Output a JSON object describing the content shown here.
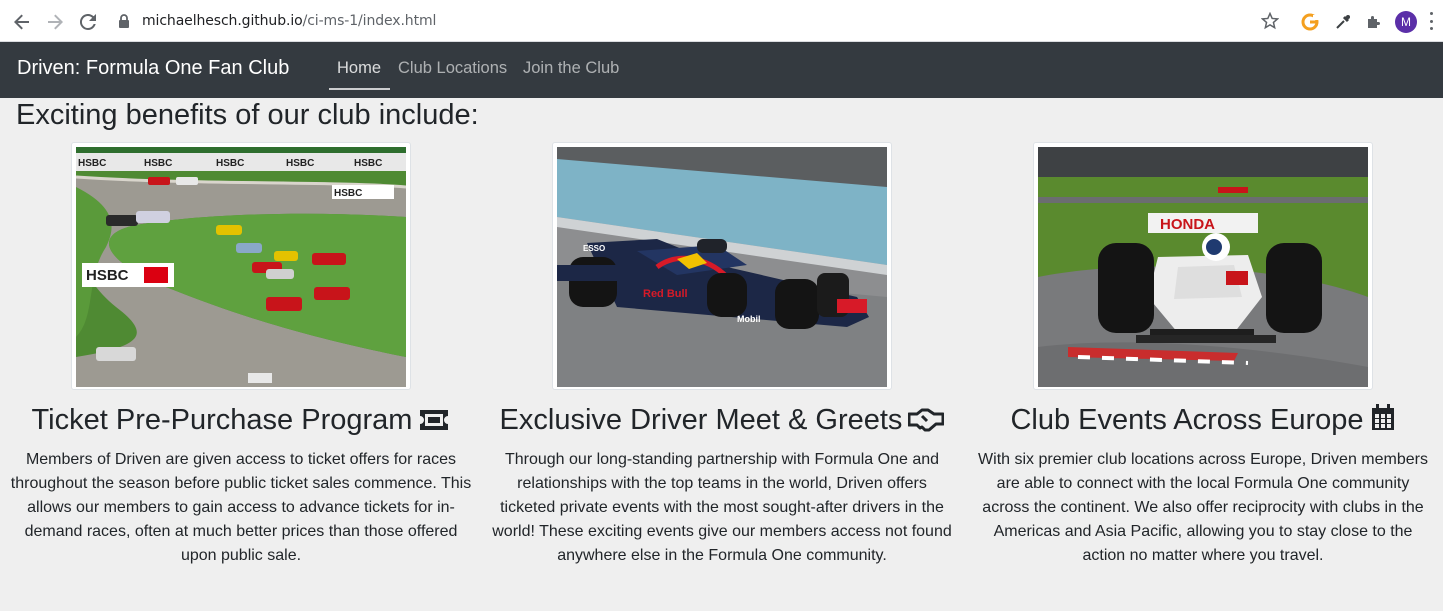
{
  "browser": {
    "url_host": "michaelhesch.github.io",
    "url_path": "/ci-ms-1/index.html",
    "profile_initial": "M"
  },
  "navbar": {
    "brand": "Driven: Formula One Fan Club",
    "links": [
      {
        "label": "Home",
        "active": true
      },
      {
        "label": "Club Locations",
        "active": false
      },
      {
        "label": "Join the Club",
        "active": false
      }
    ]
  },
  "main": {
    "heading": "Exciting benefits of our club include:",
    "cards": [
      {
        "title": "Ticket Pre-Purchase Program",
        "icon": "ticket-icon",
        "image": "race-cars-on-track-photo",
        "text": "Members of Driven are given access to ticket offers for races throughout the season before public ticket sales commence. This allows our members to gain access to advance tickets for in-demand races, often at much better prices than those offered upon public sale."
      },
      {
        "title": "Exclusive Driver Meet & Greets",
        "icon": "handshake-icon",
        "image": "red-bull-f1-car-photo",
        "text": "Through our long-standing partnership with Formula One and relationships with the top teams in the world, Driven offers ticketed private events with the most sought-after drivers in the world! These exciting events give our members access not found anywhere else in the Formula One community."
      },
      {
        "title": "Club Events Across Europe",
        "icon": "calendar-icon",
        "image": "honda-f1-car-photo",
        "text": "With six premier club locations across Europe, Driven members are able to connect with the local Formula One community across the continent. We also offer reciprocity with clubs in the Americas and Asia Pacific, allowing you to stay close to the action no matter where you travel."
      }
    ]
  },
  "image_text": {
    "hsbc": "HSBC",
    "honda": "HONDA",
    "esso": "ESSO",
    "redbull": "Red Bull",
    "mobil": "Mobil"
  },
  "colors": {
    "navbar_bg": "#343a40",
    "page_bg": "#efefef",
    "text": "#212529"
  }
}
